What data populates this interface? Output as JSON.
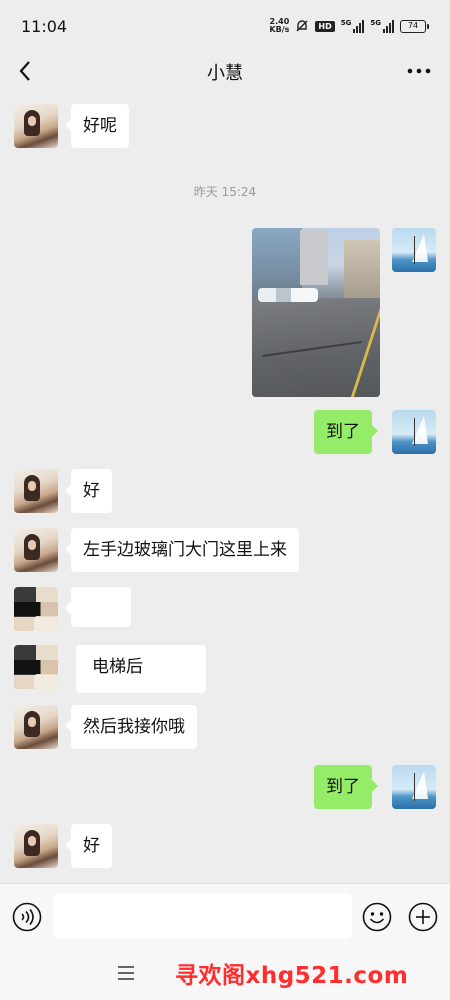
{
  "status_bar": {
    "time": "11:04",
    "net_speed_value": "2.40",
    "net_speed_unit": "KB/s",
    "hd_label": "HD",
    "sim1_label": "5G",
    "sim2_label": "5G",
    "battery": "74",
    "icons": [
      "mute-bell-icon",
      "signal-icon",
      "signal-icon",
      "battery-icon"
    ]
  },
  "nav": {
    "title": "小慧",
    "back_icon": "chevron-left-icon",
    "more_icon": "more-dots-icon"
  },
  "messages": [
    {
      "side": "left",
      "text": "好呢"
    },
    {
      "side": "right",
      "type": "image"
    },
    {
      "side": "right",
      "text": "到了"
    },
    {
      "side": "left",
      "text": "好"
    },
    {
      "side": "left",
      "text": "左手边玻璃门大门这里上来"
    },
    {
      "side": "left",
      "text": ""
    },
    {
      "side": "left",
      "text": "电梯后"
    },
    {
      "side": "left",
      "text": "然后我接你哦"
    },
    {
      "side": "right",
      "text": "到了"
    },
    {
      "side": "left",
      "text": "好"
    }
  ],
  "timestamp": "昨天 15:24",
  "input_bar": {
    "placeholder": "",
    "voice_icon": "voice-icon",
    "emoji_icon": "emoji-icon",
    "plus_icon": "plus-icon",
    "menu_icon": "menu-icon"
  },
  "watermark": "寻欢阁xhg521.com",
  "colors": {
    "background": "#ededed",
    "bubble_sent": "#95ec69",
    "bubble_received": "#ffffff",
    "watermark": "#ff2d2d"
  }
}
